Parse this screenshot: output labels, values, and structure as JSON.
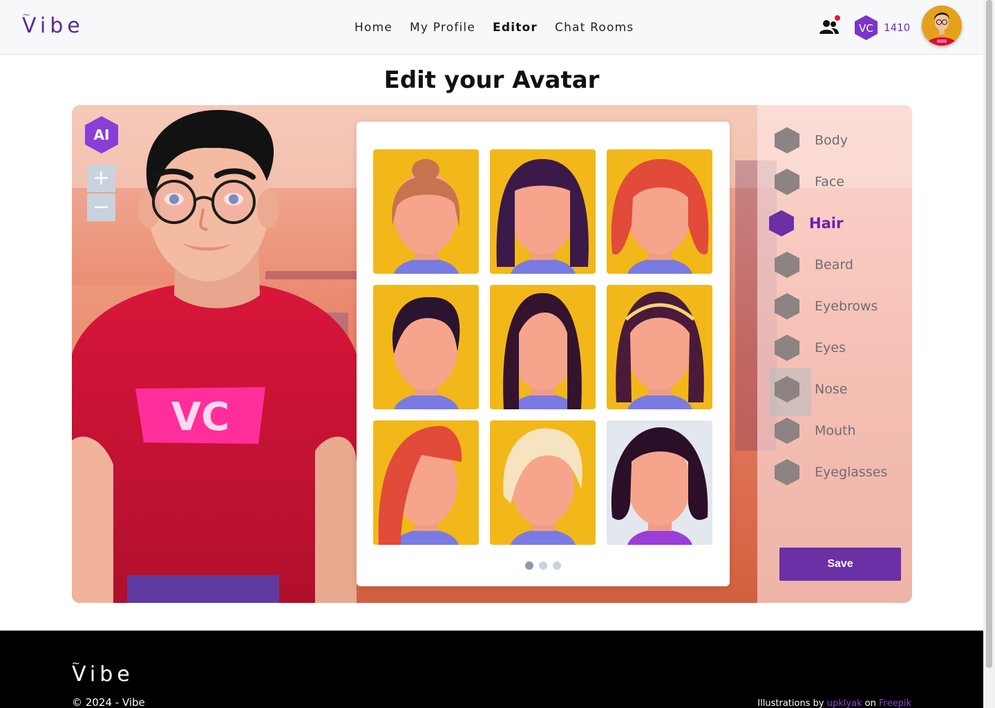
{
  "header": {
    "logo": "Vibe",
    "nav": [
      "Home",
      "My Profile",
      "Editor",
      "Chat Rooms"
    ],
    "active_nav": "Editor",
    "currency_badge": "VC",
    "currency_amount": "1410",
    "friends_icon": "friends-icon",
    "has_notification": true
  },
  "page": {
    "title": "Edit your Avatar"
  },
  "editor": {
    "ai_badge": "AI",
    "zoom_in": "+",
    "zoom_out": "−",
    "shirt_logo": "VC",
    "hair_options": [
      {
        "style": "top-bun",
        "color": "#c8734f"
      },
      {
        "style": "straight-bangs",
        "color": "#3b1a4a"
      },
      {
        "style": "wavy",
        "color": "#e24a3a"
      },
      {
        "style": "short-messy",
        "color": "#2a1430"
      },
      {
        "style": "long-straight",
        "color": "#33132e"
      },
      {
        "style": "headband-long",
        "color": "#4a1a3a"
      },
      {
        "style": "side-long",
        "color": "#e24a3a"
      },
      {
        "style": "pixie",
        "color": "#f6e3c0"
      },
      {
        "style": "bob",
        "color": "#2b0f28",
        "selected": true
      }
    ],
    "pagination": {
      "pages": 3,
      "current": 1
    },
    "categories": [
      "Body",
      "Face",
      "Hair",
      "Beard",
      "Eyebrows",
      "Eyes",
      "Nose",
      "Mouth",
      "Eyeglasses"
    ],
    "active_category": "Hair",
    "save_label": "Save",
    "colors": {
      "accent": "#6b2fa6",
      "tile_bg": "#f2b81a",
      "selected_tile_bg": "#e3e7ee"
    }
  },
  "footer": {
    "logo": "Vibe",
    "copyright": "© 2024 - Vibe",
    "credits_prefix": "Illustrations by",
    "credits_author": "upklyak",
    "credits_on": "on",
    "credits_site": "Freepik"
  }
}
